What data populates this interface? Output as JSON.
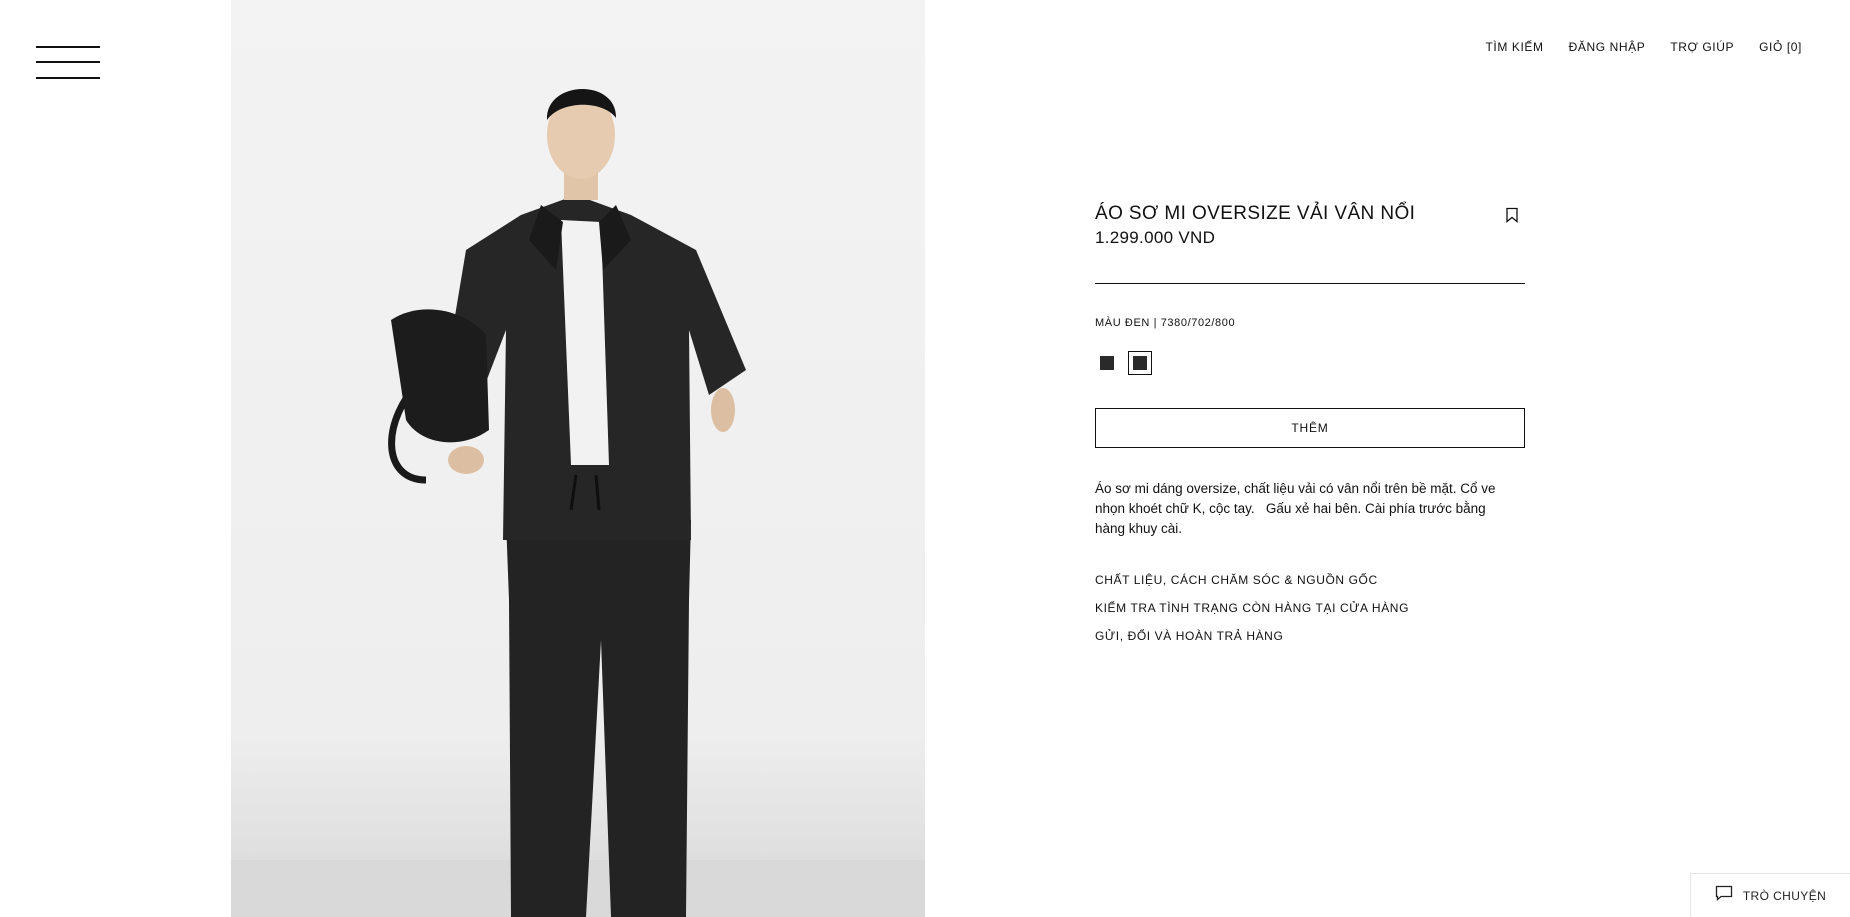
{
  "header": {
    "nav": [
      {
        "label": "TÌM KIẾM"
      },
      {
        "label": "ĐĂNG NHẬP"
      },
      {
        "label": "TRỢ GIÚP"
      },
      {
        "label": "GIỎ [0]"
      }
    ]
  },
  "product": {
    "title": "ÁO SƠ MI OVERSIZE VẢI VÂN NỔI",
    "price": "1.299.000 VND",
    "color_line": "MÀU ĐEN | 7380/702/800",
    "swatches": [
      {
        "color": "#2a2a2a",
        "selected": false
      },
      {
        "color": "#2a2a2a",
        "selected": true
      }
    ],
    "add_button": "THÊM",
    "description": "Áo sơ mi dáng oversize, chất liệu vải có vân nổi trên bề mặt. Cổ ve\nnhọn khoét chữ K, cộc tay.   Gấu xẻ hai bên. Cài phía trước bằng\nhàng khuy cài.",
    "links": [
      {
        "label": "CHẤT LIỆU, CÁCH CHĂM SÓC & NGUỒN GỐC"
      },
      {
        "label": "KIỂM TRA TÌNH TRẠNG CÒN HÀNG TẠI CỬA HÀNG"
      },
      {
        "label": "GỬI, ĐỔI VÀ HOÀN TRẢ HÀNG"
      }
    ]
  },
  "chat": {
    "label": "TRÒ CHUYỆN",
    "icon": "chat-bubble-icon"
  },
  "icons": {
    "menu": "hamburger-menu-icon",
    "bookmark": "bookmark-icon"
  }
}
